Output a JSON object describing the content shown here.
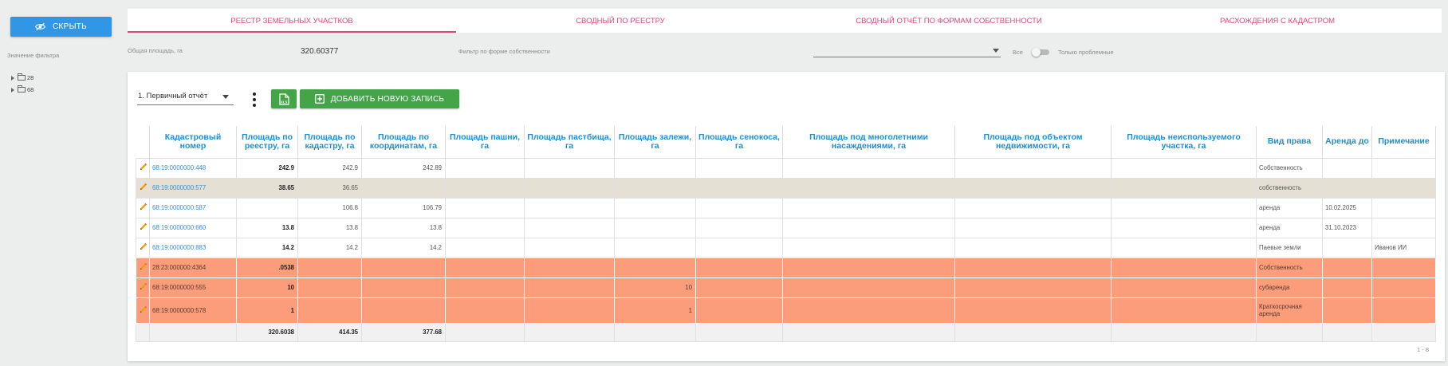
{
  "left_panel": {
    "hide_label": "СКРЫТЬ",
    "filter_label": "Значение фильтра",
    "tree": [
      {
        "label": "28"
      },
      {
        "label": "68"
      }
    ]
  },
  "tabs": [
    {
      "label": "РЕЕСТР ЗЕМЕЛЬНЫХ УЧАСТКОВ",
      "active": true
    },
    {
      "label": "СВОДНЫЙ ПО РЕЕСТРУ",
      "active": false
    },
    {
      "label": "СВОДНЫЙ ОТЧЁТ ПО ФОРМАМ СОБСТВЕННОСТИ",
      "active": false
    },
    {
      "label": "РАСХОЖДЕНИЯ С КАДАСТРОМ",
      "active": false
    }
  ],
  "info": {
    "total_label": "Общая площадь, га",
    "total_value": "320.60377",
    "ownership_filter_label": "Фильтр по форме собственности",
    "ownership_filter_value": "",
    "all_label": "Все",
    "problem_label": "Только проблемные",
    "problem_only": false
  },
  "toolbar": {
    "report_select_value": "1. Первичный отчёт",
    "xls_label": "XLS",
    "add_label": "ДОБАВИТЬ НОВУЮ ЗАПИСЬ"
  },
  "table": {
    "columns": [
      "",
      "Кадастровый номер",
      "Площадь по реестру, га",
      "Площадь по кадастру, га",
      "Площадь по координатам, га",
      "Площадь пашни, га",
      "Площадь пастбища, га",
      "Площадь залежи, га",
      "Площадь сенокоса, га",
      "Площадь под многолетними насаждениями, га",
      "Площадь под объектом недвижимости, га",
      "Площадь неиспользуемого участка, га",
      "Вид права",
      "Аренда до",
      "Примечание"
    ],
    "rows": [
      {
        "cad": "68:19:0000000:448",
        "reg": "242.9",
        "kad": "242.9",
        "coord": "242.89",
        "pash": "",
        "past": "",
        "zal": "",
        "sen": "",
        "mnog": "",
        "obj": "",
        "neisp": "",
        "vid": "Собственность",
        "ar": "",
        "prim": "",
        "style": "normal"
      },
      {
        "cad": "68:19:0000000:577",
        "reg": "38.65",
        "kad": "36.65",
        "coord": "",
        "pash": "",
        "past": "",
        "zal": "",
        "sen": "",
        "mnog": "",
        "obj": "",
        "neisp": "",
        "vid": "собственность",
        "ar": "",
        "prim": "",
        "style": "tan"
      },
      {
        "cad": "68:19:0000000:587",
        "reg": "",
        "kad": "106.8",
        "coord": "106.79",
        "pash": "",
        "past": "",
        "zal": "",
        "sen": "",
        "mnog": "",
        "obj": "",
        "neisp": "",
        "vid": "аренда",
        "ar": "10.02.2025",
        "prim": "",
        "style": "normal"
      },
      {
        "cad": "68:19:0000000:660",
        "reg": "13.8",
        "kad": "13.8",
        "coord": "13.8",
        "pash": "",
        "past": "",
        "zal": "",
        "sen": "",
        "mnog": "",
        "obj": "",
        "neisp": "",
        "vid": "аренда",
        "ar": "31.10.2023",
        "prim": "",
        "style": "normal"
      },
      {
        "cad": "68:19:0000000:883",
        "reg": "14.2",
        "kad": "14.2",
        "coord": "14.2",
        "pash": "",
        "past": "",
        "zal": "",
        "sen": "",
        "mnog": "",
        "obj": "",
        "neisp": "",
        "vid": "Паевые земли",
        "ar": "",
        "prim": "Иванов ИИ",
        "style": "normal"
      },
      {
        "cad": "28:23:000000:4364",
        "reg": ".0538",
        "kad": "",
        "coord": "",
        "pash": "",
        "past": "",
        "zal": "",
        "sen": "",
        "mnog": "",
        "obj": "",
        "neisp": "",
        "vid": "Собственность",
        "ar": "",
        "prim": "",
        "style": "red"
      },
      {
        "cad": "68:19:0000000:555",
        "reg": "10",
        "kad": "",
        "coord": "",
        "pash": "",
        "past": "",
        "zal": "10",
        "sen": "",
        "mnog": "",
        "obj": "",
        "neisp": "",
        "vid": "субаренда",
        "ar": "",
        "prim": "",
        "style": "red"
      },
      {
        "cad": "68:19:0000000:578",
        "reg": "1",
        "kad": "",
        "coord": "",
        "pash": "",
        "past": "",
        "zal": "1",
        "sen": "",
        "mnog": "",
        "obj": "",
        "neisp": "",
        "vid": "Краткосрочная аренда",
        "ar": "",
        "prim": "",
        "style": "red-tall"
      }
    ],
    "totals": {
      "reg": "320.6038",
      "kad": "414.35",
      "coord": "377.68"
    }
  },
  "pager": "1 - 8",
  "colors": {
    "accent_blue": "#2f97e5",
    "tab_pink": "#e0457b",
    "header_blue": "#1d8fd6",
    "green": "#43a548",
    "problem_row": "#fb9d7b",
    "warning_row": "#e6e0d4",
    "pencil": "#f0a100"
  },
  "icons": {
    "hide": "eye-off-icon",
    "more": "dots-vertical-icon",
    "xls": "file-excel-icon",
    "add": "plus-box-icon",
    "edit": "pencil-icon",
    "folder": "folder-icon"
  }
}
